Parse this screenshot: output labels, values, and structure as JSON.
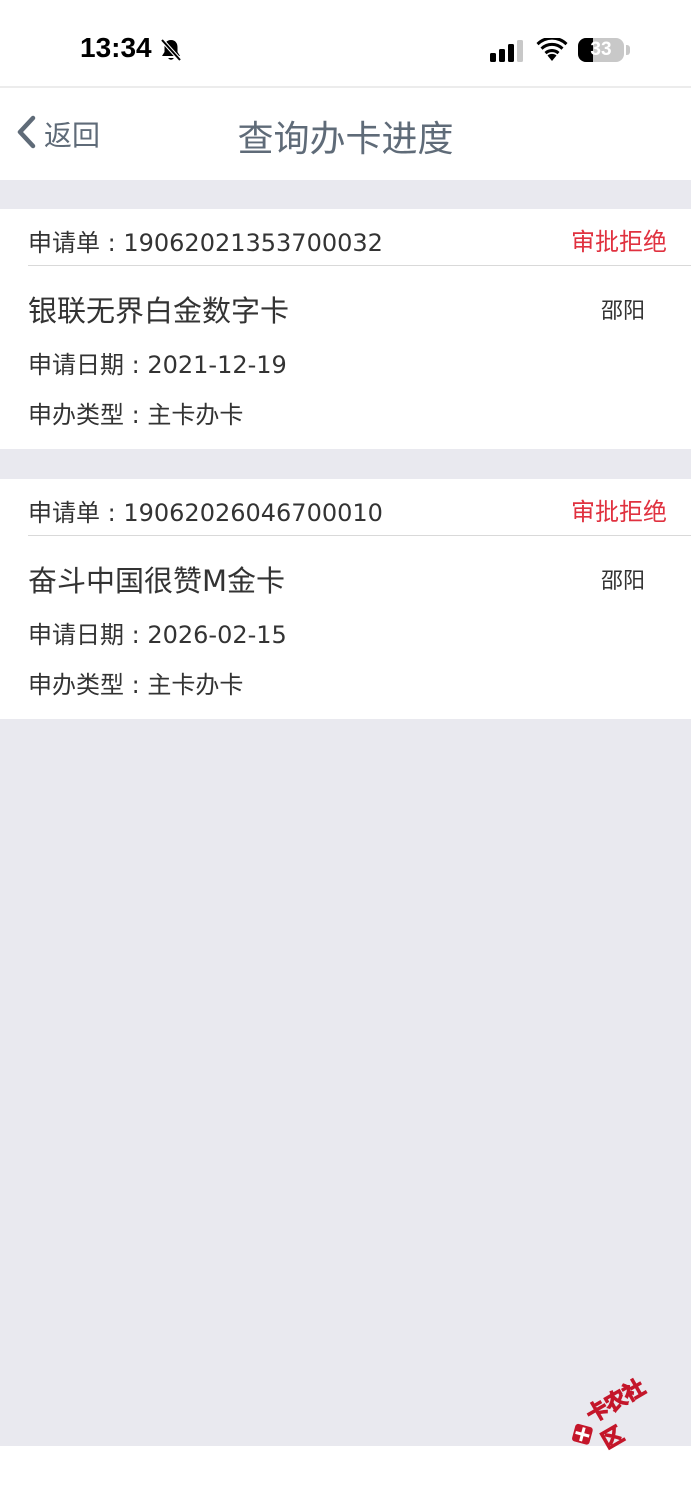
{
  "status_bar": {
    "time": "13:34",
    "battery_level": "33",
    "icons": [
      "bell-off-icon",
      "cellular-signal-icon",
      "wifi-icon",
      "battery-icon"
    ]
  },
  "nav": {
    "back_label": "返回",
    "title": "查询办卡进度"
  },
  "applications": [
    {
      "app_no": "申请单 : 19062021353700032",
      "status": "审批拒绝",
      "card_name": "银联无界白金数字卡",
      "city": "邵阳",
      "date": "申请日期 : 2021-12-19",
      "type": "申办类型 : 主卡办卡"
    },
    {
      "app_no": "申请单 : 19062026046700010",
      "status": "审批拒绝",
      "card_name": "奋斗中国很赞M金卡",
      "city": "邵阳",
      "date": "申请日期 : 2026-02-15",
      "type": "申办类型 : 主卡办卡"
    }
  ],
  "watermark": {
    "text": "卡农社区"
  },
  "colors": {
    "background": "#e9e9ef",
    "nav_text": "#5f6b78",
    "status_reject": "#e0313f",
    "watermark_red": "#c4162a"
  }
}
